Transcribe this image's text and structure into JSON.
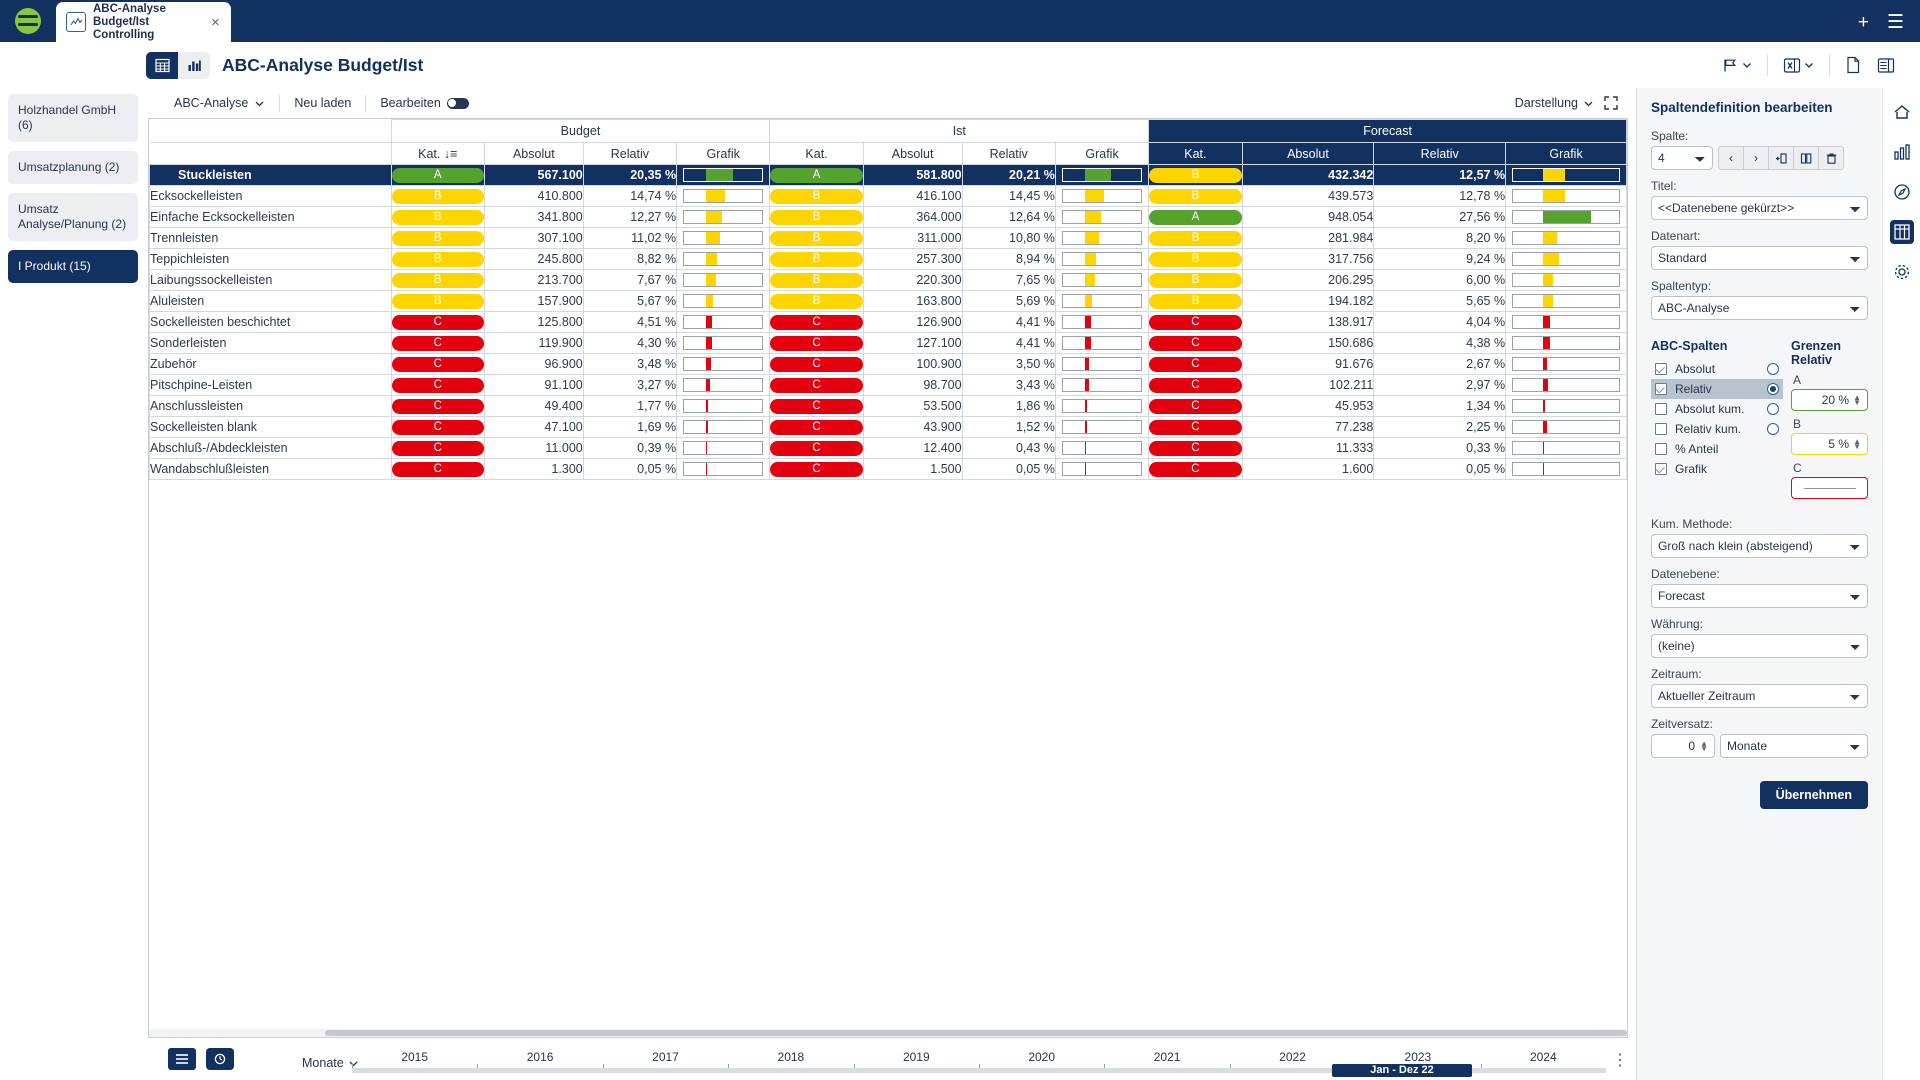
{
  "topbar": {
    "tab": {
      "title_line1": "ABC-Analyse Budget/Ist",
      "title_line2": "Controlling",
      "icon": "chart-report-icon",
      "close": "×"
    },
    "new_tab": "+",
    "menu": "☰"
  },
  "pagehead": {
    "view_table": "table-view-icon",
    "view_chart": "bar-chart-view-icon",
    "title": "ABC-Analyse Budget/Ist",
    "flag_label": "",
    "sheet_label": "",
    "doc_label": "",
    "layout_label": ""
  },
  "sidebar": {
    "items": [
      {
        "label": "Holzhandel GmbH (6)",
        "selected": false
      },
      {
        "label": "Umsatzplanung (2)",
        "selected": false
      },
      {
        "label": "Umsatz Analyse/Planung (2)",
        "selected": false
      },
      {
        "label": "I Produkt (15)",
        "selected": true
      }
    ]
  },
  "toolbar": {
    "analysis_dropdown": "ABC-Analyse",
    "reload": "Neu laden",
    "edit_label": "Bearbeiten",
    "edit_on": false,
    "darstellung": "Darstellung",
    "fullscreen_icon": "expand-icon"
  },
  "table": {
    "groups": [
      {
        "label": "Budget",
        "span": 4,
        "highlight": false
      },
      {
        "label": "Ist",
        "span": 4,
        "highlight": false
      },
      {
        "label": "Forecast",
        "span": 4,
        "highlight": true
      }
    ],
    "columns": [
      "Kat. ↓≡",
      "Absolut",
      "Relativ",
      "Grafik",
      "Kat.",
      "Absolut",
      "Relativ",
      "Grafik",
      "Kat.",
      "Absolut",
      "Relativ",
      "Grafik"
    ],
    "rows": [
      {
        "name": "Stuckleisten",
        "selected": true,
        "budget": {
          "kat": "A",
          "absolut": "567.100",
          "relativ": "20,35 %",
          "bar": 20.35
        },
        "ist": {
          "kat": "A",
          "absolut": "581.800",
          "relativ": "20,21 %",
          "bar": 20.21
        },
        "forecast": {
          "kat": "B",
          "absolut": "432.342",
          "relativ": "12,57 %",
          "bar": 12.57
        }
      },
      {
        "name": "Ecksockelleisten",
        "selected": false,
        "budget": {
          "kat": "B",
          "absolut": "410.800",
          "relativ": "14,74 %",
          "bar": 14.74
        },
        "ist": {
          "kat": "B",
          "absolut": "416.100",
          "relativ": "14,45 %",
          "bar": 14.45
        },
        "forecast": {
          "kat": "B",
          "absolut": "439.573",
          "relativ": "12,78 %",
          "bar": 12.78
        }
      },
      {
        "name": "Einfache Ecksockelleisten",
        "selected": false,
        "budget": {
          "kat": "B",
          "absolut": "341.800",
          "relativ": "12,27 %",
          "bar": 12.27
        },
        "ist": {
          "kat": "B",
          "absolut": "364.000",
          "relativ": "12,64 %",
          "bar": 12.64
        },
        "forecast": {
          "kat": "A",
          "absolut": "948.054",
          "relativ": "27,56 %",
          "bar": 27.56
        }
      },
      {
        "name": "Trennleisten",
        "selected": false,
        "budget": {
          "kat": "B",
          "absolut": "307.100",
          "relativ": "11,02 %",
          "bar": 11.02
        },
        "ist": {
          "kat": "B",
          "absolut": "311.000",
          "relativ": "10,80 %",
          "bar": 10.8
        },
        "forecast": {
          "kat": "B",
          "absolut": "281.984",
          "relativ": "8,20 %",
          "bar": 8.2
        }
      },
      {
        "name": "Teppichleisten",
        "selected": false,
        "budget": {
          "kat": "B",
          "absolut": "245.800",
          "relativ": "8,82 %",
          "bar": 8.82
        },
        "ist": {
          "kat": "B",
          "absolut": "257.300",
          "relativ": "8,94 %",
          "bar": 8.94
        },
        "forecast": {
          "kat": "B",
          "absolut": "317.756",
          "relativ": "9,24 %",
          "bar": 9.24
        }
      },
      {
        "name": "Laibungssockelleisten",
        "selected": false,
        "budget": {
          "kat": "B",
          "absolut": "213.700",
          "relativ": "7,67 %",
          "bar": 7.67
        },
        "ist": {
          "kat": "B",
          "absolut": "220.300",
          "relativ": "7,65 %",
          "bar": 7.65
        },
        "forecast": {
          "kat": "B",
          "absolut": "206.295",
          "relativ": "6,00 %",
          "bar": 6.0
        }
      },
      {
        "name": "Aluleisten",
        "selected": false,
        "budget": {
          "kat": "B",
          "absolut": "157.900",
          "relativ": "5,67 %",
          "bar": 5.67
        },
        "ist": {
          "kat": "B",
          "absolut": "163.800",
          "relativ": "5,69 %",
          "bar": 5.69
        },
        "forecast": {
          "kat": "B",
          "absolut": "194.182",
          "relativ": "5,65 %",
          "bar": 5.65
        }
      },
      {
        "name": "Sockelleisten beschichtet",
        "selected": false,
        "budget": {
          "kat": "C",
          "absolut": "125.800",
          "relativ": "4,51 %",
          "bar": 4.51
        },
        "ist": {
          "kat": "C",
          "absolut": "126.900",
          "relativ": "4,41 %",
          "bar": 4.41
        },
        "forecast": {
          "kat": "C",
          "absolut": "138.917",
          "relativ": "4,04 %",
          "bar": 4.04
        }
      },
      {
        "name": "Sonderleisten",
        "selected": false,
        "budget": {
          "kat": "C",
          "absolut": "119.900",
          "relativ": "4,30 %",
          "bar": 4.3
        },
        "ist": {
          "kat": "C",
          "absolut": "127.100",
          "relativ": "4,41 %",
          "bar": 4.41
        },
        "forecast": {
          "kat": "C",
          "absolut": "150.686",
          "relativ": "4,38 %",
          "bar": 4.38
        }
      },
      {
        "name": "Zubehör",
        "selected": false,
        "budget": {
          "kat": "C",
          "absolut": "96.900",
          "relativ": "3,48 %",
          "bar": 3.48
        },
        "ist": {
          "kat": "C",
          "absolut": "100.900",
          "relativ": "3,50 %",
          "bar": 3.5
        },
        "forecast": {
          "kat": "C",
          "absolut": "91.676",
          "relativ": "2,67 %",
          "bar": 2.67
        }
      },
      {
        "name": "Pitschpine-Leisten",
        "selected": false,
        "budget": {
          "kat": "C",
          "absolut": "91.100",
          "relativ": "3,27 %",
          "bar": 3.27
        },
        "ist": {
          "kat": "C",
          "absolut": "98.700",
          "relativ": "3,43 %",
          "bar": 3.43
        },
        "forecast": {
          "kat": "C",
          "absolut": "102.211",
          "relativ": "2,97 %",
          "bar": 2.97
        }
      },
      {
        "name": "Anschlussleisten",
        "selected": false,
        "budget": {
          "kat": "C",
          "absolut": "49.400",
          "relativ": "1,77 %",
          "bar": 1.77
        },
        "ist": {
          "kat": "C",
          "absolut": "53.500",
          "relativ": "1,86 %",
          "bar": 1.86
        },
        "forecast": {
          "kat": "C",
          "absolut": "45.953",
          "relativ": "1,34 %",
          "bar": 1.34
        }
      },
      {
        "name": "Sockelleisten blank",
        "selected": false,
        "budget": {
          "kat": "C",
          "absolut": "47.100",
          "relativ": "1,69 %",
          "bar": 1.69
        },
        "ist": {
          "kat": "C",
          "absolut": "43.900",
          "relativ": "1,52 %",
          "bar": 1.52
        },
        "forecast": {
          "kat": "C",
          "absolut": "77.238",
          "relativ": "2,25 %",
          "bar": 2.25
        }
      },
      {
        "name": "Abschluß-/Abdeckleisten",
        "selected": false,
        "budget": {
          "kat": "C",
          "absolut": "11.000",
          "relativ": "0,39 %",
          "bar": 0.39
        },
        "ist": {
          "kat": "C",
          "absolut": "12.400",
          "relativ": "0,43 %",
          "bar": 0.43
        },
        "forecast": {
          "kat": "C",
          "absolut": "11.333",
          "relativ": "0,33 %",
          "bar": 0.33
        }
      },
      {
        "name": "Wandabschlußleisten",
        "selected": false,
        "budget": {
          "kat": "C",
          "absolut": "1.300",
          "relativ": "0,05 %",
          "bar": 0.05
        },
        "ist": {
          "kat": "C",
          "absolut": "1.500",
          "relativ": "0,05 %",
          "bar": 0.05
        },
        "forecast": {
          "kat": "C",
          "absolut": "1.600",
          "relativ": "0,05 %",
          "bar": 0.05
        }
      }
    ]
  },
  "timeline": {
    "granularity": "Monate",
    "years": [
      "2015",
      "2016",
      "2017",
      "2018",
      "2019",
      "2020",
      "2021",
      "2022",
      "2023",
      "2024"
    ],
    "selection_label": "Jan - Dez 22",
    "kebab": "⋮"
  },
  "rightpanel": {
    "title": "Spaltendefinition bearbeiten",
    "spalte_label": "Spalte:",
    "spalte_value": "4",
    "nav": {
      "prev": "‹",
      "next": "›",
      "insert": "insert-column-icon",
      "duplicate": "duplicate-column-icon",
      "delete": "trash-icon"
    },
    "titel_label": "Titel:",
    "titel_value": "<<Datenebene gekürzt>>",
    "datenart_label": "Datenart:",
    "datenart_value": "Standard",
    "spaltentyp_label": "Spaltentyp:",
    "spaltentyp_value": "ABC-Analyse",
    "abc_columns_title": "ABC-Spalten",
    "grenzen_title": "Grenzen Relativ",
    "abc_items": [
      {
        "label": "Absolut",
        "checked": true,
        "radio": false
      },
      {
        "label": "Relativ",
        "checked": true,
        "radio": true
      },
      {
        "label": "Absolut kum.",
        "checked": false,
        "radio": false
      },
      {
        "label": "Relativ kum.",
        "checked": false,
        "radio": false
      },
      {
        "label": "% Anteil",
        "checked": false,
        "radio": null
      },
      {
        "label": "Grafik",
        "checked": true,
        "radio": null
      }
    ],
    "limits": [
      {
        "letter": "A",
        "value": "20 %",
        "color": "#56a22e"
      },
      {
        "letter": "B",
        "value": "5 %",
        "color": "#ffd500"
      },
      {
        "letter": "C",
        "value": "",
        "color": "#e3000f"
      }
    ],
    "kum_methode_label": "Kum. Methode:",
    "kum_methode_value": "Groß nach klein (absteigend)",
    "datenebene_label": "Datenebene:",
    "datenebene_value": "Forecast",
    "waehrung_label": "Währung:",
    "waehrung_value": "(keine)",
    "zeitraum_label": "Zeitraum:",
    "zeitraum_value": "Aktueller Zeitraum",
    "zeitversatz_label": "Zeitversatz:",
    "zeitversatz_value": "0",
    "zeitversatz_unit": "Monate",
    "apply": "Übernehmen"
  },
  "colors": {
    "brand_dark": "#123060",
    "cat_a": "#56a22e",
    "cat_b": "#ffd500",
    "cat_c": "#e3000f",
    "logo_green": "#8cc63e"
  }
}
